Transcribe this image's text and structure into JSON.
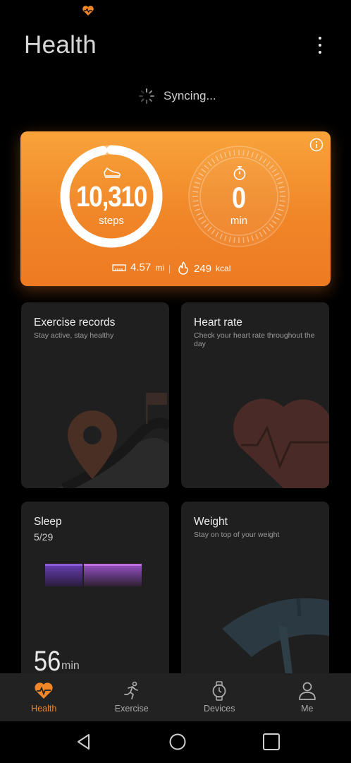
{
  "status_bar": {
    "icon": "heart-icon"
  },
  "header": {
    "title": "Health",
    "menu_icon": "more-vertical-icon"
  },
  "sync": {
    "text": "Syncing...",
    "icon": "spinner-icon"
  },
  "summary": {
    "steps_value": "10,310",
    "steps_unit": "steps",
    "steps_progress": 0.97,
    "active_value": "0",
    "active_unit": "min",
    "distance_value": "4.57",
    "distance_unit": "mi",
    "calories_value": "249",
    "calories_unit": "kcal",
    "accent_color": "#f08628"
  },
  "cards": {
    "exercise": {
      "title": "Exercise records",
      "subtitle": "Stay active, stay healthy"
    },
    "heart_rate": {
      "title": "Heart rate",
      "subtitle": "Check your heart rate throughout the day"
    },
    "sleep": {
      "title": "Sleep",
      "date": "5/29",
      "value": "56",
      "unit": "min"
    },
    "weight": {
      "title": "Weight",
      "subtitle": "Stay on top of your weight"
    }
  },
  "bottom_nav": [
    {
      "label": "Health",
      "icon": "health-heart-icon",
      "active": true
    },
    {
      "label": "Exercise",
      "icon": "running-icon",
      "active": false
    },
    {
      "label": "Devices",
      "icon": "watch-icon",
      "active": false
    },
    {
      "label": "Me",
      "icon": "person-icon",
      "active": false
    }
  ],
  "system_nav": [
    "back",
    "home",
    "recents"
  ]
}
